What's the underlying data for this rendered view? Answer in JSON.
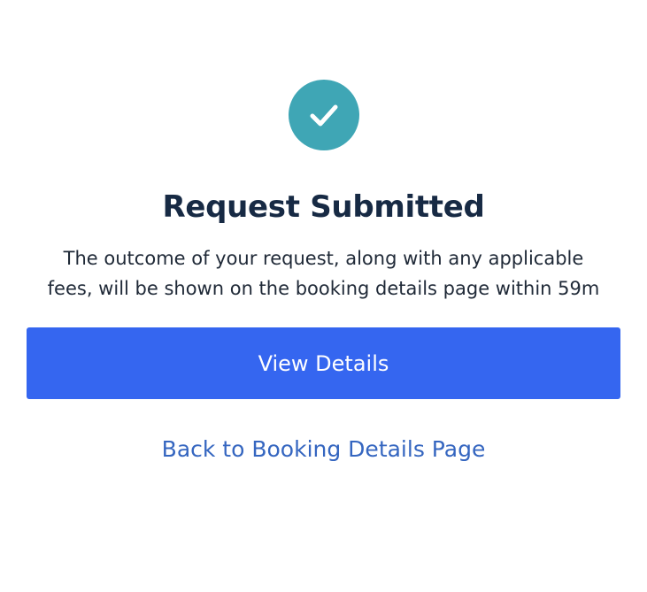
{
  "status_icon": {
    "name": "checkmark-icon",
    "color": "#3fa6b5"
  },
  "title": "Request Submitted",
  "description": {
    "line1": "The outcome of your request, along with any applicable",
    "line2": "fees, will be shown on the booking details page within 59m"
  },
  "primary_button": {
    "label": "View Details",
    "color": "#3566f0"
  },
  "back_link": {
    "label": "Back to Booking Details Page",
    "color": "#3566c0"
  }
}
